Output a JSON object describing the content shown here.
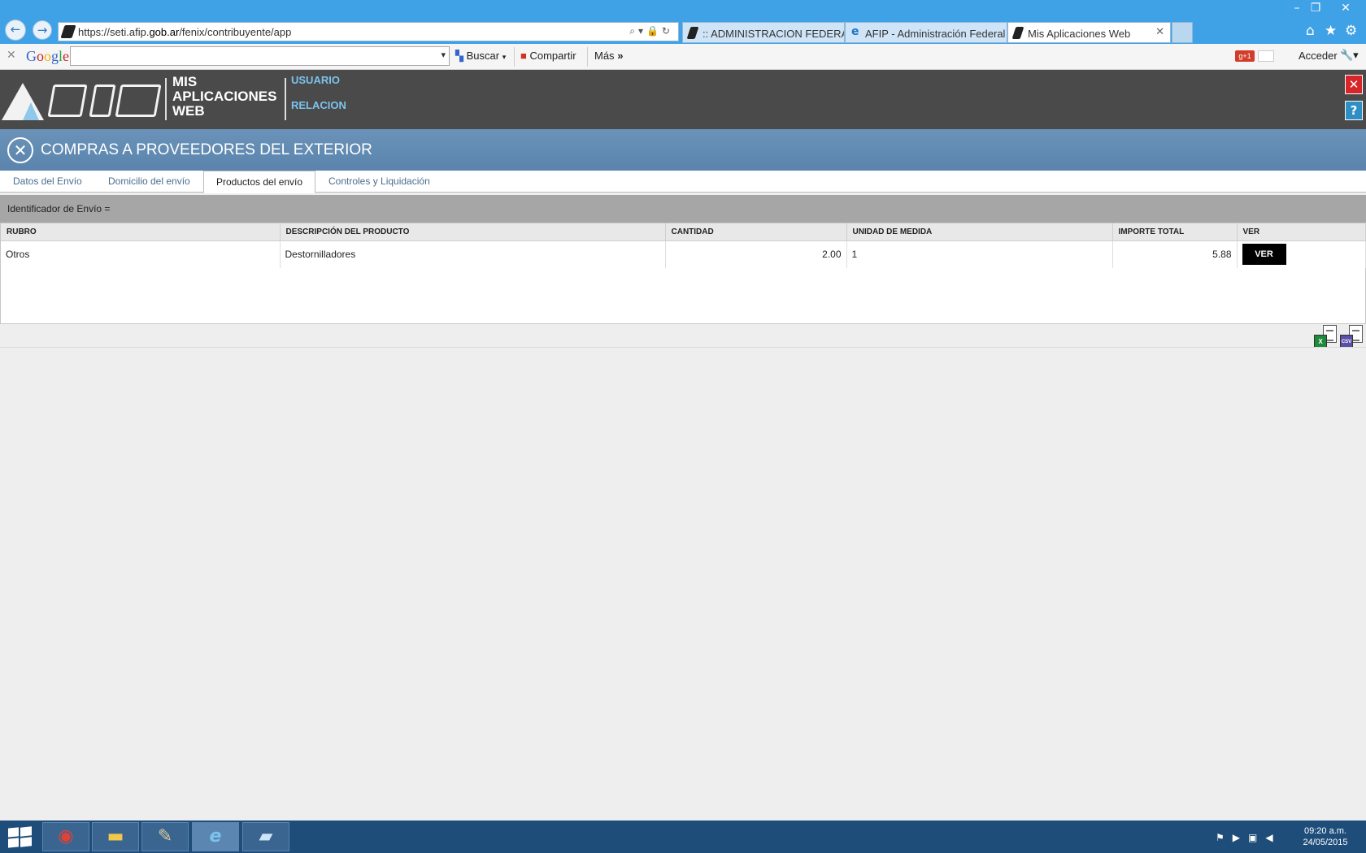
{
  "browser": {
    "url_prefix": "https://seti.afip.",
    "url_domain": "gob.ar",
    "url_path": "/fenix/contribuyente/app",
    "tabs": [
      {
        "label": ":: ADMINISTRACION FEDERAL ..."
      },
      {
        "label": "AFIP - Administración Federal"
      },
      {
        "label": "Mis Aplicaciones Web"
      }
    ],
    "window_controls": {
      "minimize": "–",
      "restore": "❐",
      "close": "✕"
    }
  },
  "google_toolbar": {
    "logo": "Google",
    "search_value": "",
    "buscar_label": "Buscar",
    "compartir_label": "Compartir",
    "mas_label": "Más",
    "acceder_label": "Acceder"
  },
  "app": {
    "name_line1": "MIS",
    "name_line2": "APLICACIONES",
    "name_line3": "WEB",
    "link_usuario": "USUARIO",
    "link_relacion": "RELACION",
    "close_btn": "✕",
    "help_btn": "?"
  },
  "section": {
    "title": "COMPRAS A PROVEEDORES DEL EXTERIOR"
  },
  "tabs": [
    {
      "label": "Datos del Envío"
    },
    {
      "label": "Domicilio del envío"
    },
    {
      "label": "Productos del envío"
    },
    {
      "label": "Controles y Liquidación"
    }
  ],
  "identificador": "Identificador de Envío =",
  "table": {
    "columns": [
      "RUBRO",
      "DESCRIPCIÓN DEL PRODUCTO",
      "CANTIDAD",
      "UNIDAD DE MEDIDA",
      "IMPORTE TOTAL",
      "VER"
    ],
    "rows": [
      {
        "rubro": "Otros",
        "descripcion": "Destornilladores",
        "cantidad": "2.00",
        "unidad": "1",
        "importe": "5.88",
        "ver": "VER"
      }
    ]
  },
  "export": {
    "excel_badge": "X",
    "csv_badge": "CSV"
  },
  "taskbar": {
    "time": "09:20 a.m.",
    "date": "24/05/2015"
  },
  "colors": {
    "header_bg": "#4a4a4a",
    "section_bg": "#5a84ad",
    "link": "#7cc3ec",
    "taskbar": "#1f4d7a"
  }
}
